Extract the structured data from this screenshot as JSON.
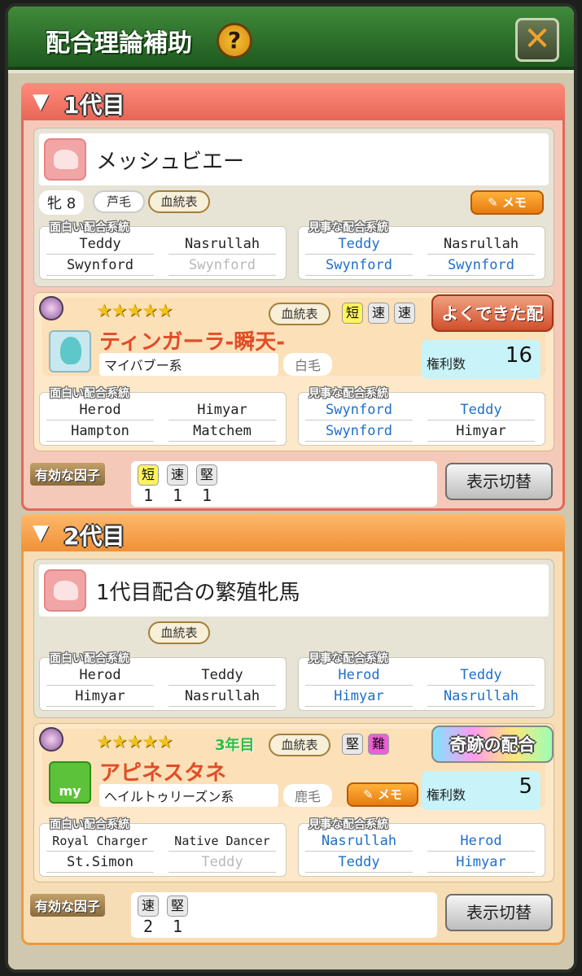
{
  "title": "配合理論補助",
  "help_label": "?",
  "close_label": "✕",
  "gen1": {
    "header": "1代目",
    "mare": {
      "name": "メッシュビエー",
      "sex_age": "牝 8",
      "coat": "芦毛",
      "pedigree_btn": "血統表",
      "memo_btn": "メモ",
      "interesting_label": "面白い配合系統",
      "interesting": [
        "Teddy",
        "Nasrullah",
        "Swynford",
        "Swynford"
      ],
      "splendid_label": "見事な配合系統",
      "splendid": [
        "Teddy",
        "Nasrullah",
        "Swynford",
        "Swynford"
      ]
    },
    "sire": {
      "stars": "★★★★★",
      "pedigree_btn": "血統表",
      "factors": [
        "短",
        "速",
        "速"
      ],
      "badge": "よくできた配合",
      "name": "ティンガーラ-瞬天-",
      "line": "マイバブー系",
      "coat": "白毛",
      "rights_label": "権利数",
      "rights_value": "16",
      "interesting_label": "面白い配合系統",
      "interesting": [
        "Herod",
        "Himyar",
        "Hampton",
        "Matchem"
      ],
      "splendid_label": "見事な配合系統",
      "splendid": [
        "Swynford",
        "Teddy",
        "Swynford",
        "Himyar"
      ]
    },
    "effective_label": "有効な因子",
    "effective_factors": [
      "短",
      "速",
      "堅"
    ],
    "effective_counts": [
      "1",
      "1",
      "1"
    ],
    "toggle_btn": "表示切替"
  },
  "gen2": {
    "header": "2代目",
    "mare": {
      "name": "1代目配合の繁殖牝馬",
      "pedigree_btn": "血統表",
      "interesting_label": "面白い配合系統",
      "interesting": [
        "Herod",
        "Teddy",
        "Himyar",
        "Nasrullah"
      ],
      "splendid_label": "見事な配合系統",
      "splendid": [
        "Herod",
        "Teddy",
        "Himyar",
        "Nasrullah"
      ]
    },
    "sire": {
      "stars": "★★★★★",
      "year": "3年目",
      "pedigree_btn": "血統表",
      "factors": [
        "堅",
        "難"
      ],
      "badge": "奇跡の配合",
      "icon_text": "my",
      "name": "アピネスタネ",
      "line": "ヘイルトゥリーズン系",
      "coat": "鹿毛",
      "memo_btn": "メモ",
      "rights_label": "権利数",
      "rights_value": "5",
      "interesting_label": "面白い配合系統",
      "interesting": [
        "Royal Charger",
        "Native Dancer",
        "St.Simon",
        "Teddy"
      ],
      "splendid_label": "見事な配合系統",
      "splendid": [
        "Nasrullah",
        "Herod",
        "Teddy",
        "Himyar"
      ]
    },
    "effective_label": "有効な因子",
    "effective_factors": [
      "速",
      "堅"
    ],
    "effective_counts": [
      "2",
      "1"
    ],
    "toggle_btn": "表示切替"
  },
  "colors": {
    "title_green": "#2f7a2c",
    "gen1_red": "#e76656",
    "gen2_orange": "#ef9138",
    "blue_text": "#1e6fc8",
    "sire_name_red": "#e04d26"
  }
}
